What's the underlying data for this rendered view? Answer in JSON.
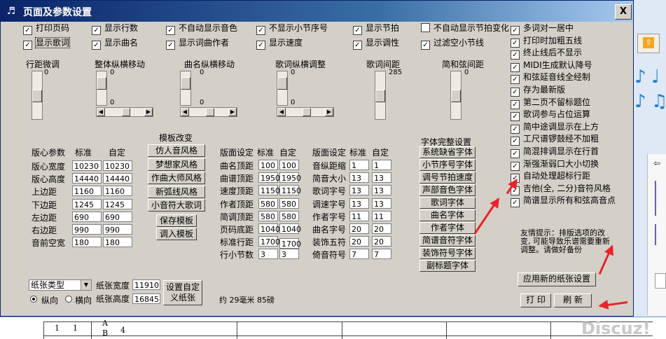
{
  "window": {
    "title": "页面及参数设置",
    "close": "X"
  },
  "checks": {
    "row1": [
      {
        "label": "打印页码",
        "checked": true
      },
      {
        "label": "显示行数",
        "checked": true
      },
      {
        "label": "不自动显示音色",
        "checked": true
      },
      {
        "label": "不显示小节序号",
        "checked": true
      },
      {
        "label": "显示节拍",
        "checked": true
      },
      {
        "label": "不自动显示节拍变化",
        "checked": false
      }
    ],
    "row2": [
      {
        "label": "显示歌词",
        "checked": true
      },
      {
        "label": "显示曲名",
        "checked": true
      },
      {
        "label": "显示词曲作者",
        "checked": true
      },
      {
        "label": "显示速度",
        "checked": true
      },
      {
        "label": "显示调性",
        "checked": true
      },
      {
        "label": "过滤空小节线",
        "checked": true
      }
    ],
    "right": [
      {
        "label": "多词对一居中",
        "checked": true
      },
      {
        "label": "打印时加粗五线",
        "checked": true
      },
      {
        "label": "终止线后不显示",
        "checked": true
      },
      {
        "label": "MIDI生成默认降号",
        "checked": true
      },
      {
        "label": "和弦延音线全经制",
        "checked": true
      },
      {
        "label": "存为最新版",
        "checked": true
      },
      {
        "label": "第二页不留标题位",
        "checked": true
      },
      {
        "label": "歌词参与占位运算",
        "checked": true
      },
      {
        "label": "简中途调显示在上方",
        "checked": true
      },
      {
        "label": "工尺谱锣鼓经不加粗",
        "checked": true
      },
      {
        "label": "简混排调显示在行首",
        "checked": true
      },
      {
        "label": "渐强渐弱口大小切换",
        "checked": true
      },
      {
        "label": "自动处理超标行距",
        "checked": true
      },
      {
        "label": "吉他(全, 二分)音符风格",
        "checked": true
      },
      {
        "label": "简谱显示所有和弦高音点",
        "checked": true
      }
    ]
  },
  "sliders": {
    "hangju": {
      "label": "行距微调",
      "value": "0"
    },
    "zhengti": {
      "label": "整体纵横移动",
      "v": "0",
      "h": "0"
    },
    "quming": {
      "label": "曲名纵横移动",
      "v": "0",
      "h": "0"
    },
    "geci": {
      "label": "歌词纵横调整",
      "v": "0",
      "h": "0"
    },
    "gecijianju": {
      "label": "歌词间距",
      "value": "285"
    },
    "jianhexian": {
      "label": "简和弦间距",
      "value": "0"
    }
  },
  "banxin": {
    "header": [
      "版心参数",
      "标准",
      "自定"
    ],
    "rows": [
      {
        "label": "版心宽度",
        "std": "10230",
        "custom": "10230"
      },
      {
        "label": "版心高度",
        "std": "14440",
        "custom": "14440"
      },
      {
        "label": "上边距",
        "std": "1160",
        "custom": "1160"
      },
      {
        "label": "下边距",
        "std": "1245",
        "custom": "1245"
      },
      {
        "label": "左边距",
        "std": "690",
        "custom": "690"
      },
      {
        "label": "右边距",
        "std": "990",
        "custom": "990"
      },
      {
        "label": "音前空宽",
        "std": "180",
        "custom": "180"
      }
    ]
  },
  "template": {
    "title": "模板改变",
    "buttons": [
      "仿人音风格",
      "梦想家风格",
      "作曲大师风格",
      "新弧线风格",
      "小音符大歌词",
      "保存模板",
      "调入模板"
    ]
  },
  "layout1": {
    "header": [
      "版面设定",
      "标准",
      "自定"
    ],
    "rows": [
      {
        "label": "曲名顶距",
        "std": "100",
        "custom": "100"
      },
      {
        "label": "曲谱顶距",
        "std": "1950",
        "custom": "1950"
      },
      {
        "label": "速度顶距",
        "std": "1150",
        "custom": "1150"
      },
      {
        "label": "作者顶距",
        "std": "580",
        "custom": "580"
      },
      {
        "label": "简调顶距",
        "std": "580",
        "custom": "580"
      },
      {
        "label": "页码底距",
        "std": "1040",
        "custom": "1040"
      },
      {
        "label": "标准行距",
        "std": "1700",
        "custom": "1700"
      },
      {
        "label": "行小节数",
        "std": "3",
        "custom": "3"
      }
    ]
  },
  "layout2": {
    "header": [
      "版面设定",
      "标准",
      "自定"
    ],
    "rows": [
      {
        "label": "音纵距缩",
        "std": "1",
        "custom": "1"
      },
      {
        "label": "简音大小",
        "std": "13",
        "custom": "13"
      },
      {
        "label": "歌词字号",
        "std": "13",
        "custom": "13"
      },
      {
        "label": "调速字号",
        "std": "13",
        "custom": "13"
      },
      {
        "label": "作者字号",
        "std": "11",
        "custom": "11"
      },
      {
        "label": "曲名字号",
        "std": "20",
        "custom": "20"
      },
      {
        "label": "装饰五符",
        "std": "20",
        "custom": "20"
      },
      {
        "label": "倚音符号",
        "std": "7",
        "custom": "7"
      }
    ]
  },
  "fonts": {
    "title": "字体完整设置",
    "buttons": [
      "系统缺省字体",
      "小节序号字体",
      "调号节拍速度",
      "声部音色字体",
      "歌词字体",
      "曲名字体",
      "作者字体",
      "简谱音符字体",
      "装饰符号字体",
      "副标题字体"
    ]
  },
  "paper": {
    "type": "纸张类型",
    "width_label": "纸张宽度",
    "width": "11910",
    "height_label": "纸张高度",
    "height": "16845",
    "portrait": "纵向",
    "landscape": "横向",
    "custom_button": "设置自定义纸张",
    "info": "约 29毫米 85磅"
  },
  "tip": "友情提示：排版选项的改变, 可能导致乐谱需要重新调整。请做好备份",
  "actions": {
    "apply": "应用新的纸张设置",
    "print": "打 印",
    "refresh": "刷 新"
  },
  "background": {
    "watermark": "Discuz!",
    "score": [
      "1",
      "1",
      "A",
      "B",
      "4"
    ]
  },
  "colors": {
    "title_start": "#0a246a",
    "title_end": "#a6caf0",
    "dialog": "#d4d0c8",
    "arrow": "#e8242a"
  }
}
